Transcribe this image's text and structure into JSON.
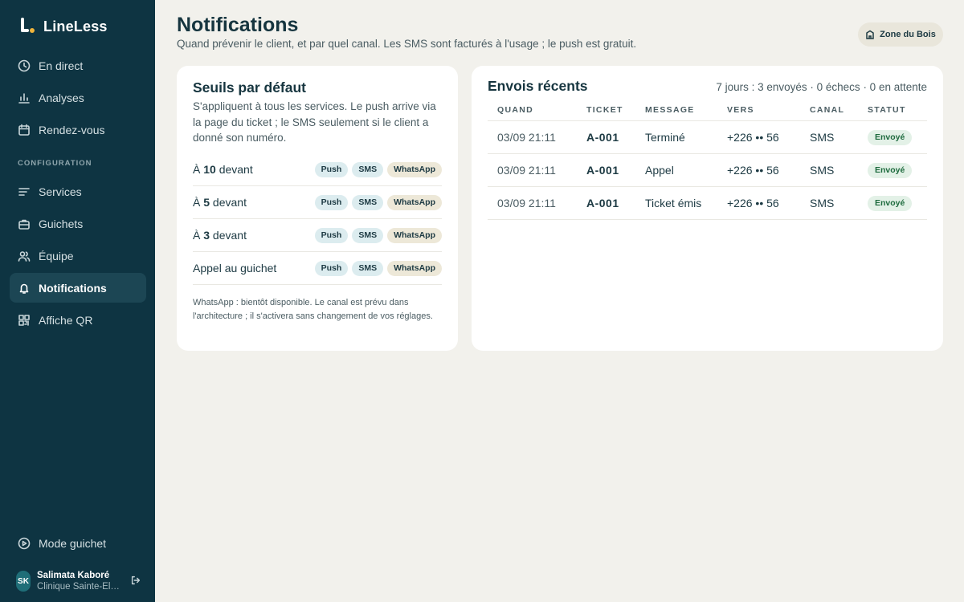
{
  "brand": {
    "name": "LineLess"
  },
  "nav": {
    "items": [
      {
        "label": "En direct",
        "icon": "clock-icon"
      },
      {
        "label": "Analyses",
        "icon": "bar-chart-icon"
      },
      {
        "label": "Rendez-vous",
        "icon": "calendar-icon"
      }
    ],
    "section_label": "CONFIGURATION",
    "config_items": [
      {
        "label": "Services",
        "icon": "list-icon"
      },
      {
        "label": "Guichets",
        "icon": "briefcase-icon"
      },
      {
        "label": "Équipe",
        "icon": "users-icon"
      },
      {
        "label": "Notifications",
        "icon": "bell-icon",
        "active": true
      },
      {
        "label": "Affiche QR",
        "icon": "qr-icon"
      }
    ],
    "mode_label": "Mode guichet"
  },
  "user": {
    "initials": "SK",
    "name": "Salimata Kaboré",
    "org": "Clinique Sainte-Élisabeth"
  },
  "header": {
    "title": "Notifications",
    "subtitle": "Quand prévenir le client, et par quel canal. Les SMS sont facturés à l'usage ; le push est gratuit.",
    "location": "Zone du Bois"
  },
  "defaults": {
    "title": "Seuils par défaut",
    "description": "S'appliquent à tous les services. Le push arrive via la page du ticket ; le SMS seulement si le client a donné son numéro.",
    "rows": [
      {
        "prefix": "À ",
        "count": "10",
        "suffix": " devant"
      },
      {
        "prefix": "À ",
        "count": "5",
        "suffix": " devant"
      },
      {
        "prefix": "À ",
        "count": "3",
        "suffix": " devant"
      },
      {
        "prefix": "Appel au guichet",
        "count": "",
        "suffix": ""
      }
    ],
    "channels": {
      "push": "Push",
      "sms": "SMS",
      "whatsapp": "WhatsApp"
    },
    "note": "WhatsApp : bientôt disponible. Le canal est prévu dans l'architecture ; il s'activera sans changement de vos réglages."
  },
  "recent": {
    "title": "Envois récents",
    "summary": "7 jours : 3 envoyés · 0 échecs · 0 en attente",
    "columns": [
      "QUAND",
      "TICKET",
      "MESSAGE",
      "VERS",
      "CANAL",
      "STATUT"
    ],
    "rows": [
      {
        "when": "03/09 21:11",
        "ticket": "A-001",
        "message": "Terminé",
        "to": "+226 •• 56",
        "channel": "SMS",
        "status": "Envoyé"
      },
      {
        "when": "03/09 21:11",
        "ticket": "A-001",
        "message": "Appel",
        "to": "+226 •• 56",
        "channel": "SMS",
        "status": "Envoyé"
      },
      {
        "when": "03/09 21:11",
        "ticket": "A-001",
        "message": "Ticket émis",
        "to": "+226 •• 56",
        "channel": "SMS",
        "status": "Envoyé"
      }
    ]
  }
}
